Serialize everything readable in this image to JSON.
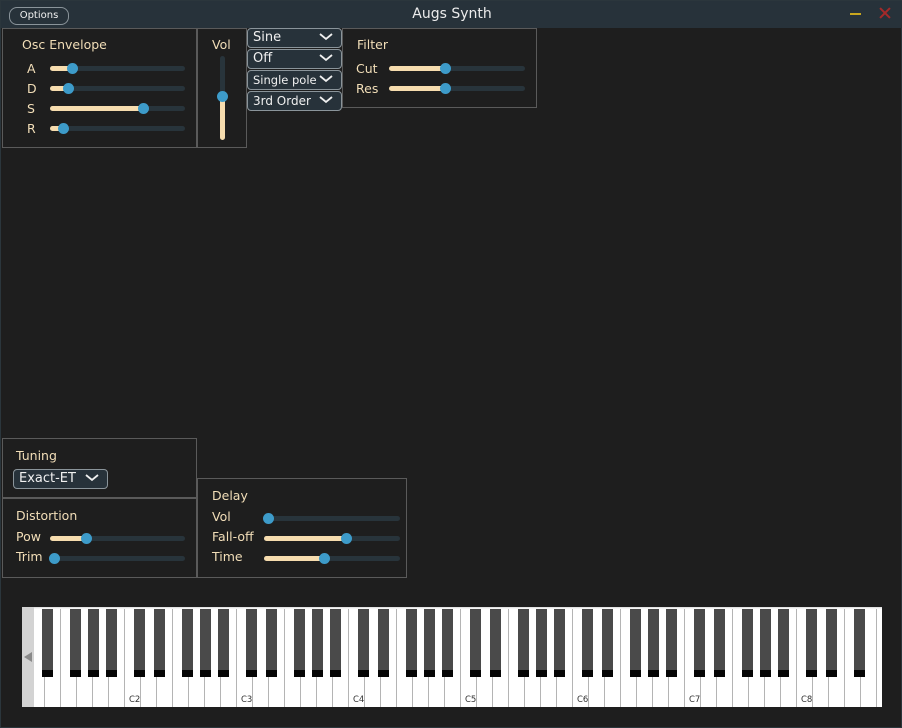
{
  "window": {
    "title": "Augs Synth",
    "options_label": "Options",
    "minimize_color": "#c8a61e",
    "close_color": "#a52a2a"
  },
  "theme": {
    "accent": "#3d9bc9",
    "fill": "#f6dcae",
    "track": "#28343b",
    "label": "#f2deb8"
  },
  "osc_envelope": {
    "title": "Osc Envelope",
    "sliders": [
      {
        "label": "A",
        "value": 0.14
      },
      {
        "label": "D",
        "value": 0.11
      },
      {
        "label": "S",
        "value": 0.7
      },
      {
        "label": "R",
        "value": 0.07
      }
    ]
  },
  "volume": {
    "title": "Vol",
    "value": 0.52
  },
  "dropdowns": [
    {
      "name": "waveform",
      "selected": "Sine"
    },
    {
      "name": "mode",
      "selected": "Off"
    },
    {
      "name": "filter-type",
      "selected": "Single pole"
    },
    {
      "name": "filter-order",
      "selected": "3rd Order"
    }
  ],
  "filter": {
    "title": "Filter",
    "sliders": [
      {
        "label": "Cut",
        "value": 0.41
      },
      {
        "label": "Res",
        "value": 0.41
      }
    ]
  },
  "tuning": {
    "title": "Tuning",
    "selected": "Exact-ET"
  },
  "distortion": {
    "title": "Distortion",
    "sliders": [
      {
        "label": "Pow",
        "value": 0.25
      },
      {
        "label": "Trim",
        "value": 0.0
      }
    ]
  },
  "delay": {
    "title": "Delay",
    "sliders": [
      {
        "label": "Vol",
        "value": 0.0
      },
      {
        "label": "Fall-off",
        "value": 0.61
      },
      {
        "label": "Time",
        "value": 0.44
      }
    ]
  },
  "keyboard": {
    "scroll_left_icon": "triangle-left",
    "first_white_note": "D1",
    "last_white_note": "G8",
    "octave_labels": [
      "C2",
      "C3",
      "C4",
      "C5",
      "C6",
      "C7",
      "C8"
    ]
  }
}
